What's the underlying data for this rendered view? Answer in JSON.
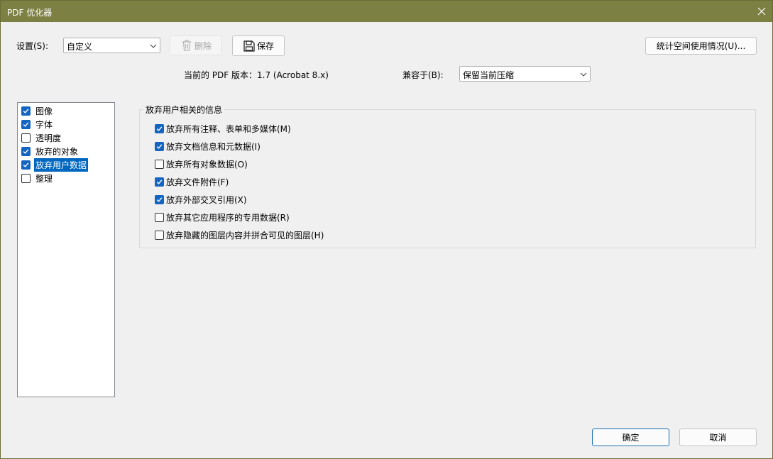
{
  "window": {
    "title": "PDF 优化器"
  },
  "toolbar": {
    "settings_label": "设置(S):",
    "settings_value": "自定义",
    "delete_label": "删除",
    "save_label": "保存",
    "audit_label": "统计空间使用情况(U)..."
  },
  "info": {
    "pdf_version_text": "当前的 PDF 版本：1.7 (Acrobat 8.x)",
    "compat_label": "兼容于(B):",
    "compat_value": "保留当前压缩"
  },
  "panels": [
    {
      "label": "图像",
      "checked": true,
      "selected": false
    },
    {
      "label": "字体",
      "checked": true,
      "selected": false
    },
    {
      "label": "透明度",
      "checked": false,
      "selected": false
    },
    {
      "label": "放弃的对象",
      "checked": true,
      "selected": false
    },
    {
      "label": "放弃用户数据",
      "checked": true,
      "selected": true
    },
    {
      "label": "整理",
      "checked": false,
      "selected": false
    }
  ],
  "group": {
    "title": "放弃用户相关的信息",
    "options": [
      {
        "label": "放弃所有注释、表单和多媒体(M)",
        "checked": true
      },
      {
        "label": "放弃文档信息和元数据(I)",
        "checked": true
      },
      {
        "label": "放弃所有对象数据(O)",
        "checked": false
      },
      {
        "label": "放弃文件附件(F)",
        "checked": true
      },
      {
        "label": "放弃外部交叉引用(X)",
        "checked": true
      },
      {
        "label": "放弃其它应用程序的专用数据(R)",
        "checked": false
      },
      {
        "label": "放弃隐藏的图层内容并拼合可见的图层(H)",
        "checked": false
      }
    ]
  },
  "footer": {
    "ok_label": "确定",
    "cancel_label": "取消"
  },
  "colors": {
    "titlebar": "#7c8043",
    "accent": "#1565c0",
    "selection": "#0067c0"
  }
}
